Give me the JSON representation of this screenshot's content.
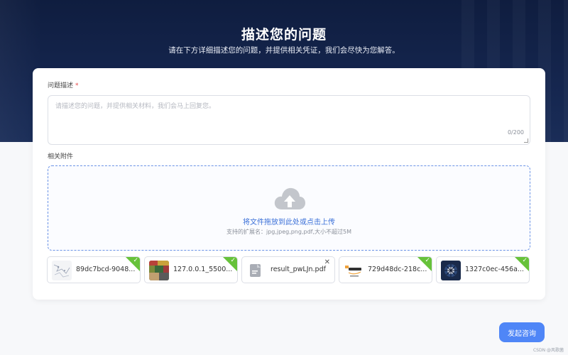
{
  "header": {
    "title": "描述您的问题",
    "subtitle": "请在下方详细描述您的问题，并提供相关凭证，我们会尽快为您解答。"
  },
  "form": {
    "description_label": "问题描述",
    "required_mark": "*",
    "description_placeholder": "请描述您的问题，并提供相关材料，我们会马上回复您。",
    "description_value": "",
    "char_count": "0/200",
    "attachments_label": "相关附件",
    "dropzone_title": "将文件拖放到此处或点击上传",
    "dropzone_hint": "支持的扩展名：jpg,jpeg,png,pdf,大小不超过5M"
  },
  "files": [
    {
      "name": "89dc7bcd-9048...",
      "icon": "image-thumbnail-icon",
      "status": "uploaded"
    },
    {
      "name": "127.0.0.1_5500...",
      "icon": "image-thumbnail-icon",
      "status": "uploaded"
    },
    {
      "name": "result_pwLJn.pdf",
      "icon": "pdf-file-icon",
      "status": "removable"
    },
    {
      "name": "729d48dc-218c...",
      "icon": "amazon-logo-thumbnail-icon",
      "status": "uploaded"
    },
    {
      "name": "1327c0ec-456a...",
      "icon": "image-thumbnail-icon",
      "status": "uploaded"
    }
  ],
  "actions": {
    "submit_label": "发起咨询"
  },
  "footer": {
    "watermark": "CSDN @风歌菌"
  },
  "colors": {
    "accent": "#4f86f7",
    "success": "#67c23a",
    "required": "#e54545",
    "hero": "#15264f"
  }
}
